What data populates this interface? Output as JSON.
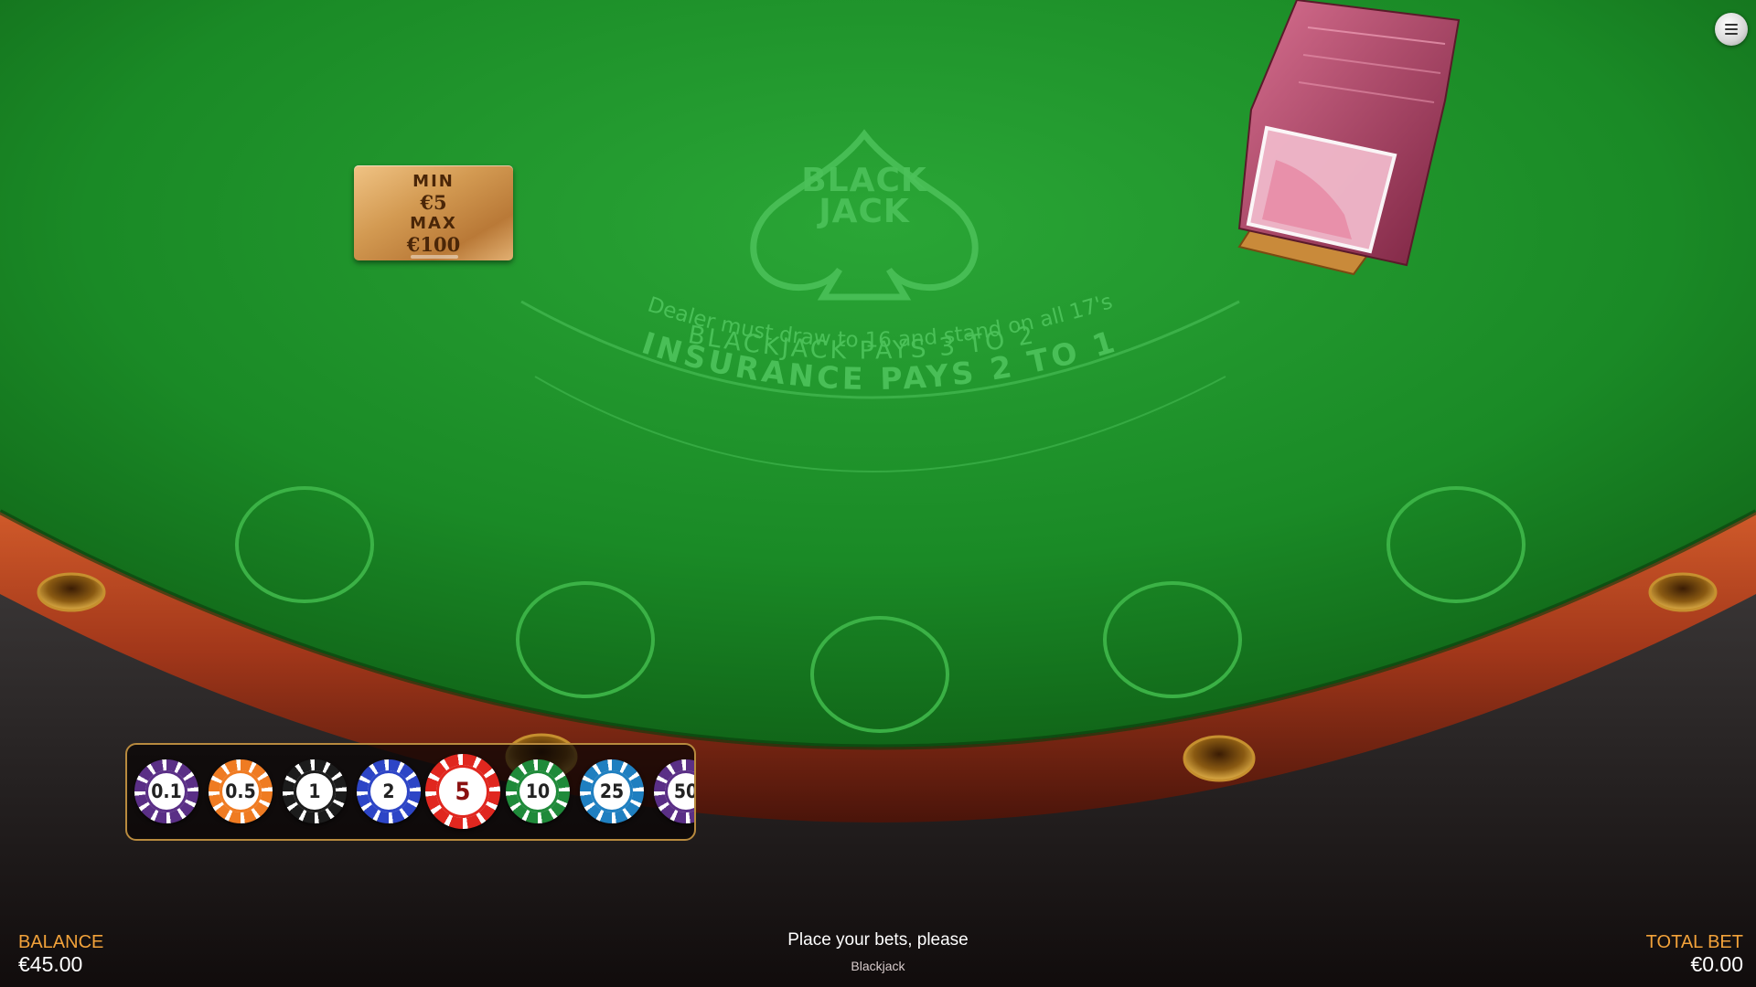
{
  "table": {
    "logo_line1": "BLACK",
    "logo_line2": "JACK",
    "rule_blackjack": "BLACKJACK PAYS 3 TO 2",
    "rule_dealer": "Dealer must draw to 16 and stand on all 17's",
    "rule_insurance": "INSURANCE PAYS 2 TO 1",
    "limits": {
      "min_label": "MIN",
      "min_value": "€5",
      "max_label": "MAX",
      "max_value": "€100"
    },
    "betting_spots": 5
  },
  "menu": {
    "icon": "hamburger-menu-icon"
  },
  "chips": [
    {
      "label": "0.1",
      "color": "#5a2f86",
      "selected": false
    },
    {
      "label": "0.5",
      "color": "#ef7b22",
      "selected": false
    },
    {
      "label": "1",
      "color": "#1c1c1c",
      "selected": false
    },
    {
      "label": "2",
      "color": "#2d45c6",
      "selected": false
    },
    {
      "label": "5",
      "color": "#e0271f",
      "selected": true
    },
    {
      "label": "10",
      "color": "#1f8a3a",
      "selected": false
    },
    {
      "label": "25",
      "color": "#1f7fc0",
      "selected": false
    },
    {
      "label": "50",
      "color": "#5a2f86",
      "selected": false
    }
  ],
  "footer": {
    "balance_label": "BALANCE",
    "balance_value": "€45.00",
    "message": "Place your bets, please",
    "game_name": "Blackjack",
    "total_bet_label": "TOTAL BET",
    "total_bet_value": "€0.00"
  },
  "colors": {
    "felt": "#1e9a2c",
    "felt_text": "#4cc25a",
    "rail": "#b3441c",
    "accent": "#f2a23a"
  }
}
